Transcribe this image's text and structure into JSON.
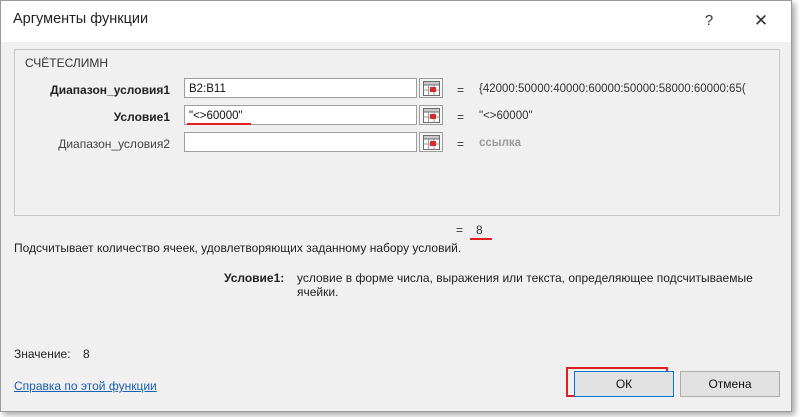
{
  "dialog": {
    "title": "Аргументы функции",
    "help_label": "?",
    "close_label": "✕"
  },
  "function": {
    "name": "СЧЁТЕСЛИМН"
  },
  "args": [
    {
      "label": "Диапазон_условия1",
      "value": "B2:B11",
      "eq": "=",
      "result": "{42000:50000:40000:60000:50000:58000:60000:65("
    },
    {
      "label": "Условие1",
      "value": "\"<>60000\"",
      "eq": "=",
      "result": "\"<>60000\""
    },
    {
      "label": "Диапазон_условия2",
      "value": "",
      "eq": "=",
      "result": "ссылка"
    }
  ],
  "result": {
    "eq": "=",
    "value": "8"
  },
  "description": "Подсчитывает количество ячеек, удовлетворяющих заданному набору условий.",
  "param_help": {
    "name": "Условие1:",
    "text": "условие в форме числа, выражения или текста, определяющее подсчитываемые ячейки."
  },
  "value_line": {
    "label": "Значение:",
    "value": "8"
  },
  "footer": {
    "help_link": "Справка по этой функции",
    "ok_label": "ОК",
    "cancel_label": "Отмена"
  },
  "colors": {
    "accent_red": "#e0201f",
    "link_blue": "#1a5fb4",
    "focus_blue": "#0078d7"
  }
}
